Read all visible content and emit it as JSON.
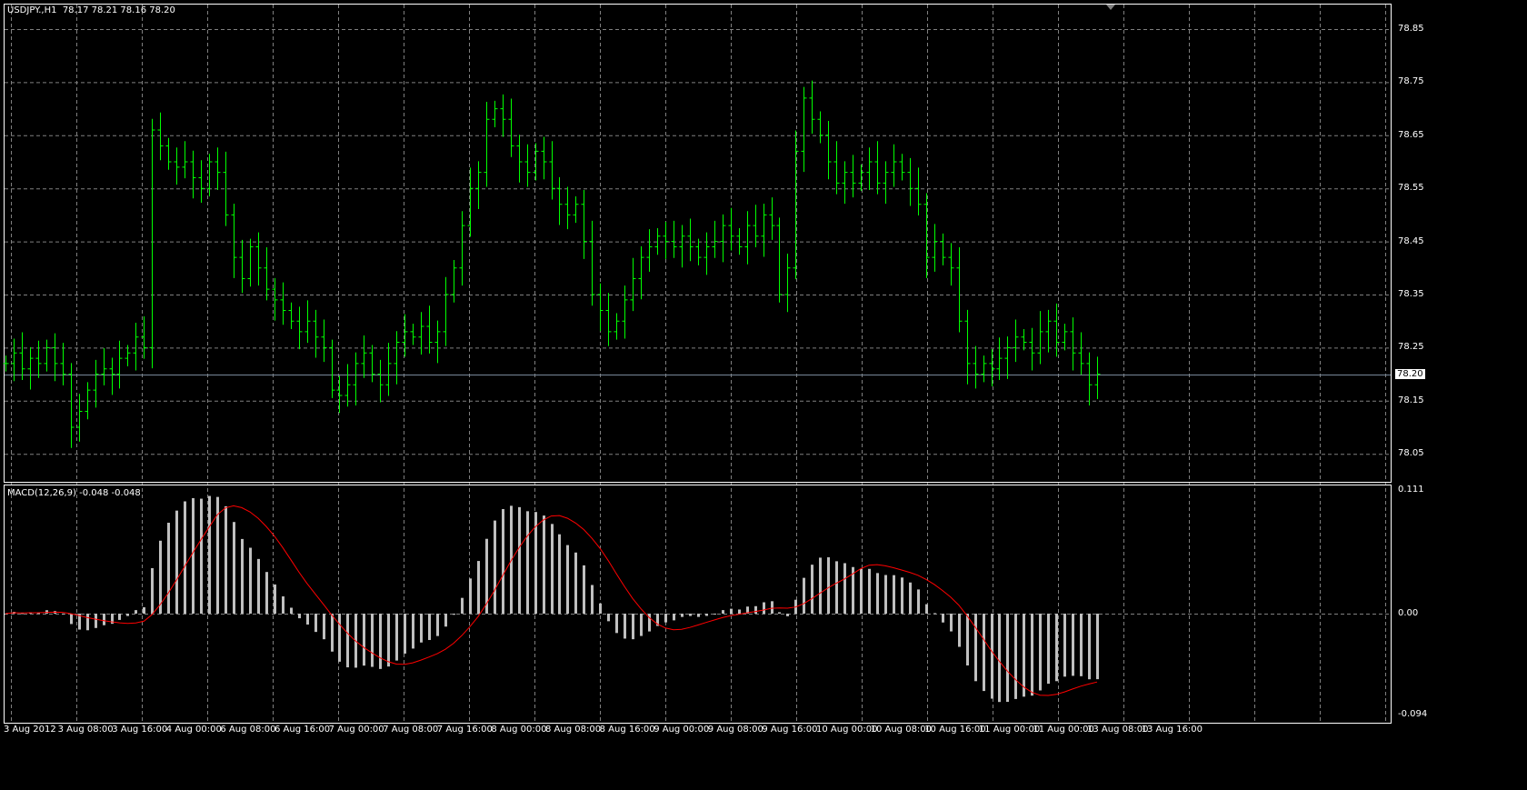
{
  "header": {
    "symbol": "USDJPY.,H1",
    "ohlc": "78.17 78.21 78.16 78.20"
  },
  "indicator": {
    "label": "MACD(12,26,9) -0.048 -0.048"
  },
  "colors": {
    "bar": "#00ff00",
    "histogram": "#c0c0c0",
    "signal": "#ff0000",
    "grid": "#808080",
    "bid_line": "#778899"
  },
  "chart_data": {
    "type": "bar",
    "title": "USDJPY.,H1",
    "price_axis": {
      "ticks": [
        "78.85",
        "78.75",
        "78.65",
        "78.55",
        "78.45",
        "78.35",
        "78.25",
        "78.15",
        "78.05"
      ],
      "range": [
        78.0,
        78.9
      ],
      "current": "78.20"
    },
    "macd_axis": {
      "ticks": [
        "0.111",
        "0.00",
        "-0.094"
      ],
      "range": [
        -0.094,
        0.111
      ]
    },
    "time_labels": [
      "3 Aug 2012",
      "3 Aug 08:00",
      "3 Aug 16:00",
      "4 Aug 00:00",
      "6 Aug 08:00",
      "6 Aug 16:00",
      "7 Aug 00:00",
      "7 Aug 08:00",
      "7 Aug 16:00",
      "8 Aug 00:00",
      "8 Aug 08:00",
      "8 Aug 16:00",
      "9 Aug 00:00",
      "9 Aug 08:00",
      "9 Aug 16:00",
      "10 Aug 00:00",
      "10 Aug 08:00",
      "10 Aug 16:00",
      "11 Aug 00:00",
      "11 Aug 00:00",
      "13 Aug 08:00",
      "13 Aug 16:00"
    ],
    "close": [
      78.22,
      78.24,
      78.21,
      78.23,
      78.22,
      78.25,
      78.22,
      78.2,
      78.1,
      78.13,
      78.17,
      78.2,
      78.21,
      78.2,
      78.23,
      78.24,
      78.27,
      78.25,
      78.66,
      78.63,
      78.6,
      78.59,
      78.6,
      78.57,
      78.55,
      78.6,
      78.58,
      78.5,
      78.42,
      78.38,
      78.44,
      78.4,
      78.36,
      78.34,
      78.32,
      78.3,
      78.28,
      78.3,
      78.27,
      78.25,
      78.17,
      78.16,
      78.18,
      78.22,
      78.24,
      78.2,
      78.18,
      78.22,
      78.26,
      78.28,
      78.27,
      78.29,
      78.26,
      78.28,
      78.35,
      78.4,
      78.48,
      78.55,
      78.58,
      78.68,
      78.7,
      78.68,
      78.63,
      78.6,
      78.58,
      78.62,
      78.6,
      78.55,
      78.52,
      78.5,
      78.52,
      78.45,
      78.35,
      78.32,
      78.28,
      78.3,
      78.34,
      78.38,
      78.42,
      78.44,
      78.46,
      78.45,
      78.44,
      78.46,
      78.44,
      78.42,
      78.44,
      78.45,
      78.48,
      78.46,
      78.44,
      78.48,
      78.46,
      78.5,
      78.48,
      78.35,
      78.4,
      78.62,
      78.72,
      78.68,
      78.65,
      78.6,
      78.56,
      78.58,
      78.56,
      78.58,
      78.6,
      78.56,
      78.58,
      78.6,
      78.58,
      78.55,
      78.52,
      78.42,
      78.45,
      78.42,
      78.4,
      78.3,
      78.22,
      78.2,
      78.22,
      78.21,
      78.23,
      78.25,
      78.27,
      78.26,
      78.24,
      78.28,
      78.3,
      78.26,
      78.28,
      78.24,
      78.22,
      78.18,
      78.2
    ]
  }
}
